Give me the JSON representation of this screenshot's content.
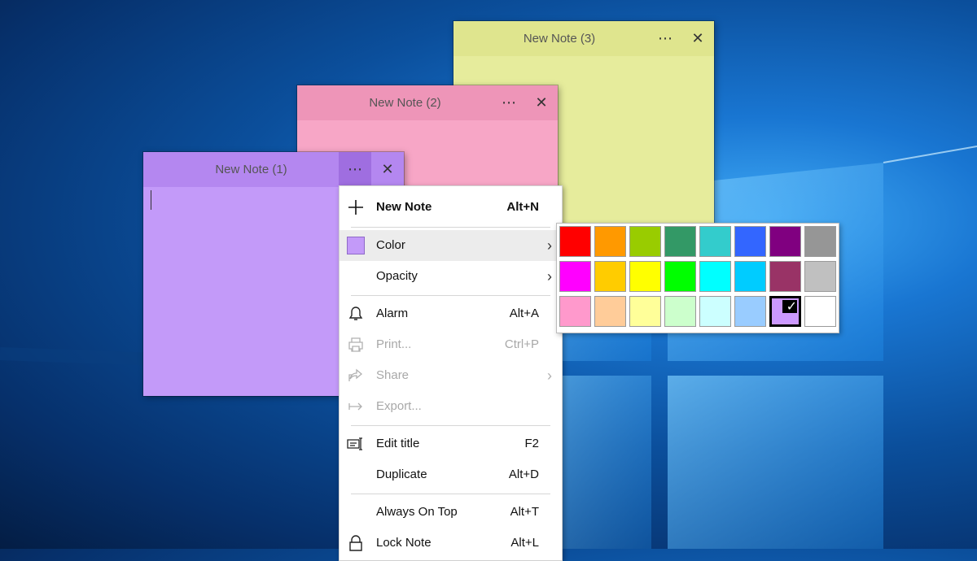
{
  "notes": [
    {
      "id": "note1",
      "title": "New Note (1)",
      "color": "#c39af9"
    },
    {
      "id": "note2",
      "title": "New Note (2)",
      "color": "#f7a6c6"
    },
    {
      "id": "note3",
      "title": "New Note (3)",
      "color": "#e6ec9c"
    }
  ],
  "note_controls": {
    "more": "⋯",
    "close": "✕"
  },
  "menu": {
    "new_note": {
      "label": "New Note",
      "shortcut": "Alt+N",
      "icon": "plus-icon"
    },
    "color": {
      "label": "Color",
      "icon": "color-swatch-icon",
      "submenu_arrow": "›"
    },
    "opacity": {
      "label": "Opacity",
      "submenu_arrow": "›"
    },
    "alarm": {
      "label": "Alarm",
      "shortcut": "Alt+A",
      "icon": "bell-icon"
    },
    "print": {
      "label": "Print...",
      "shortcut": "Ctrl+P",
      "icon": "printer-icon",
      "disabled": true
    },
    "share": {
      "label": "Share",
      "icon": "share-icon",
      "submenu_arrow": "›",
      "disabled": true
    },
    "export": {
      "label": "Export...",
      "icon": "export-arrow-icon",
      "disabled": true
    },
    "edit_title": {
      "label": "Edit title",
      "shortcut": "F2",
      "icon": "edit-title-icon"
    },
    "duplicate": {
      "label": "Duplicate",
      "shortcut": "Alt+D"
    },
    "always_on_top": {
      "label": "Always On Top",
      "shortcut": "Alt+T"
    },
    "lock_note": {
      "label": "Lock Note",
      "shortcut": "Alt+L",
      "icon": "lock-icon"
    }
  },
  "palette": {
    "rows": [
      [
        "#ff0000",
        "#ff9900",
        "#99cc00",
        "#339966",
        "#33cccc",
        "#3366ff",
        "#800080",
        "#969696"
      ],
      [
        "#ff00ff",
        "#ffcc00",
        "#ffff00",
        "#00ff00",
        "#00ffff",
        "#00ccff",
        "#993366",
        "#c0c0c0"
      ],
      [
        "#ff99cc",
        "#ffcc99",
        "#ffff99",
        "#ccffcc",
        "#ccffff",
        "#99ccff",
        "#cc99ff",
        "#ffffff"
      ]
    ],
    "selected": {
      "row": 2,
      "col": 6
    }
  }
}
